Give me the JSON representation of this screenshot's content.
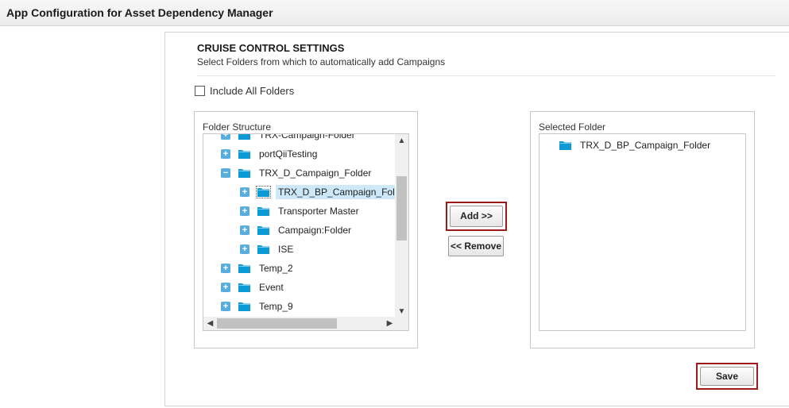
{
  "header": {
    "title": "App Configuration for Asset Dependency Manager"
  },
  "settings": {
    "title": "CRUISE CONTROL SETTINGS",
    "subtitle": "Select Folders from which to automatically add Campaigns",
    "include_all_label": "Include All Folders",
    "include_all_checked": false
  },
  "folder_structure": {
    "label": "Folder Structure",
    "nodes": [
      {
        "label": "TRX-Campaign-Folder",
        "toggle": "+"
      },
      {
        "label": "portQiiTesting",
        "toggle": "+"
      },
      {
        "label": "TRX_D_Campaign_Folder",
        "toggle": "−"
      },
      {
        "label": "TRX_D_BP_Campaign_Folder",
        "toggle": "+",
        "selected": true
      },
      {
        "label": "Transporter Master",
        "toggle": "+"
      },
      {
        "label": "Campaign:Folder",
        "toggle": "+"
      },
      {
        "label": "ISE",
        "toggle": "+"
      },
      {
        "label": "Temp_2",
        "toggle": "+"
      },
      {
        "label": "Event",
        "toggle": "+"
      },
      {
        "label": "Temp_9",
        "toggle": "+"
      }
    ]
  },
  "selected_folder": {
    "label": "Selected Folder",
    "items": [
      {
        "label": "TRX_D_BP_Campaign_Folder"
      }
    ]
  },
  "buttons": {
    "add": "Add >>",
    "remove": "<< Remove",
    "save": "Save"
  },
  "colors": {
    "folder": "#0c9ad6",
    "toggle": "#5aaede",
    "highlight": "#9b1b1b",
    "selection": "#cde8f8"
  }
}
